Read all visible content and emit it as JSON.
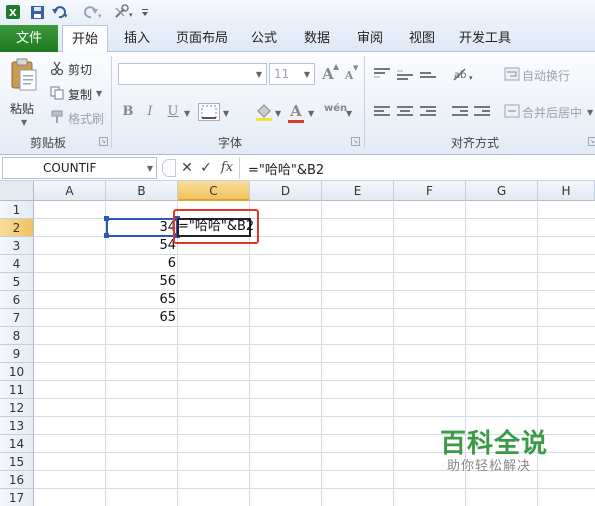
{
  "quick_access": {
    "icons": [
      "excel-logo-icon",
      "save-icon",
      "undo-icon",
      "redo-icon",
      "tools-icon",
      "customize-icon"
    ]
  },
  "tabs": [
    {
      "label": "文件"
    },
    {
      "label": "开始"
    },
    {
      "label": "插入"
    },
    {
      "label": "页面布局"
    },
    {
      "label": "公式"
    },
    {
      "label": "数据"
    },
    {
      "label": "审阅"
    },
    {
      "label": "视图"
    },
    {
      "label": "开发工具"
    }
  ],
  "ribbon": {
    "clipboard": {
      "paste_label": "粘贴",
      "cut_label": "剪切",
      "copy_label": "复制",
      "format_painter_label": "格式刷",
      "group_label": "剪贴板"
    },
    "font": {
      "font_name_value": "",
      "font_size_value": "11",
      "grow_label": "A",
      "shrink_label": "A",
      "bold_label": "B",
      "italic_label": "I",
      "underline_label": "U",
      "font_color_label": "A",
      "phonetic_label": "wén",
      "group_label": "字体"
    },
    "alignment": {
      "wrap_text_label": "自动换行",
      "merge_center_label": "合并后居中",
      "group_label": "对齐方式"
    }
  },
  "formula_bar": {
    "name_box": "COUNTIF",
    "cancel_symbol": "✕",
    "enter_symbol": "✓",
    "fx_label": "fx",
    "formula": "=\"哈哈\"&B2"
  },
  "sheet": {
    "columns": [
      "A",
      "B",
      "C",
      "D",
      "E",
      "F",
      "G",
      "H"
    ],
    "rows": [
      "1",
      "2",
      "3",
      "4",
      "5",
      "6",
      "7",
      "8",
      "9",
      "10",
      "11",
      "12",
      "13",
      "14",
      "15",
      "16",
      "17"
    ],
    "column_b_values": [
      "",
      "34",
      "54",
      "6",
      "56",
      "65",
      "65"
    ],
    "active_cell_content": "=\"哈哈\"&B2"
  },
  "watermark": {
    "title": "百科全说",
    "subtitle": "助你轻松解决"
  },
  "colors": {
    "file_tab": "#1e7a21",
    "selection_header": "#f1c15f",
    "highlight_box": "#e0372c",
    "watermark": "#3a9b47"
  }
}
